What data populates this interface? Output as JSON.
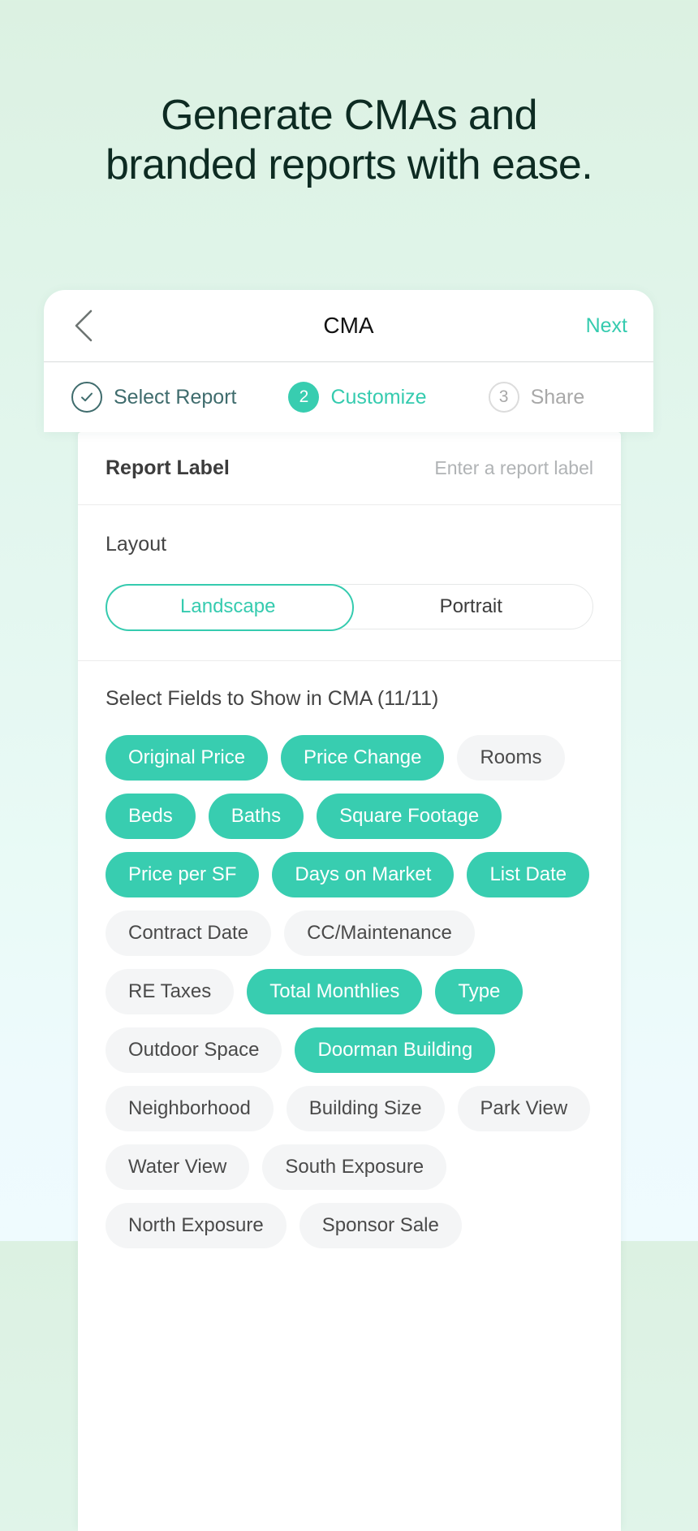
{
  "hero": {
    "line1": "Generate CMAs and",
    "line2": "branded reports with ease."
  },
  "navbar": {
    "back_icon": "chevron-left-icon",
    "title": "CMA",
    "next_label": "Next"
  },
  "stepper": {
    "steps": [
      {
        "marker": "✓",
        "label": "Select Report",
        "state": "done"
      },
      {
        "marker": "2",
        "label": "Customize",
        "state": "active"
      },
      {
        "marker": "3",
        "label": "Share",
        "state": "todo"
      }
    ]
  },
  "report_label": {
    "title": "Report Label",
    "value": "",
    "placeholder": "Enter a report label"
  },
  "layout": {
    "title": "Layout",
    "selected": "Landscape",
    "options": [
      "Landscape",
      "Portrait"
    ]
  },
  "fields": {
    "title": "Select Fields to Show in CMA (11/11)",
    "selected_count": 11,
    "total_count": 11,
    "chips": [
      {
        "label": "Original Price",
        "selected": true
      },
      {
        "label": "Price Change",
        "selected": true
      },
      {
        "label": "Rooms",
        "selected": false
      },
      {
        "label": "Beds",
        "selected": true
      },
      {
        "label": "Baths",
        "selected": true
      },
      {
        "label": "Square Footage",
        "selected": true
      },
      {
        "label": "Price per SF",
        "selected": true
      },
      {
        "label": "Days on Market",
        "selected": true
      },
      {
        "label": "List Date",
        "selected": true
      },
      {
        "label": "Contract Date",
        "selected": false
      },
      {
        "label": "CC/Maintenance",
        "selected": false
      },
      {
        "label": "RE Taxes",
        "selected": false
      },
      {
        "label": "Total Monthlies",
        "selected": true
      },
      {
        "label": "Type",
        "selected": true
      },
      {
        "label": "Outdoor Space",
        "selected": false
      },
      {
        "label": "Doorman Building",
        "selected": true
      },
      {
        "label": "Neighborhood",
        "selected": false
      },
      {
        "label": "Building Size",
        "selected": false
      },
      {
        "label": "Park View",
        "selected": false
      },
      {
        "label": "Water View",
        "selected": false
      },
      {
        "label": "South Exposure",
        "selected": false
      },
      {
        "label": "North Exposure",
        "selected": false
      },
      {
        "label": "Sponsor Sale",
        "selected": false
      }
    ]
  },
  "colors": {
    "accent_teal": "#38CDB0",
    "accent_teal_text": "#35CBAF",
    "step_done": "#3F6C6D",
    "chip_off_bg": "#F4F5F6",
    "chip_off_text": "#4A4A4A",
    "bg_top": "#DCF1E2",
    "bg_bottom": "#EFFBFE",
    "headline": "#0D2B22"
  }
}
